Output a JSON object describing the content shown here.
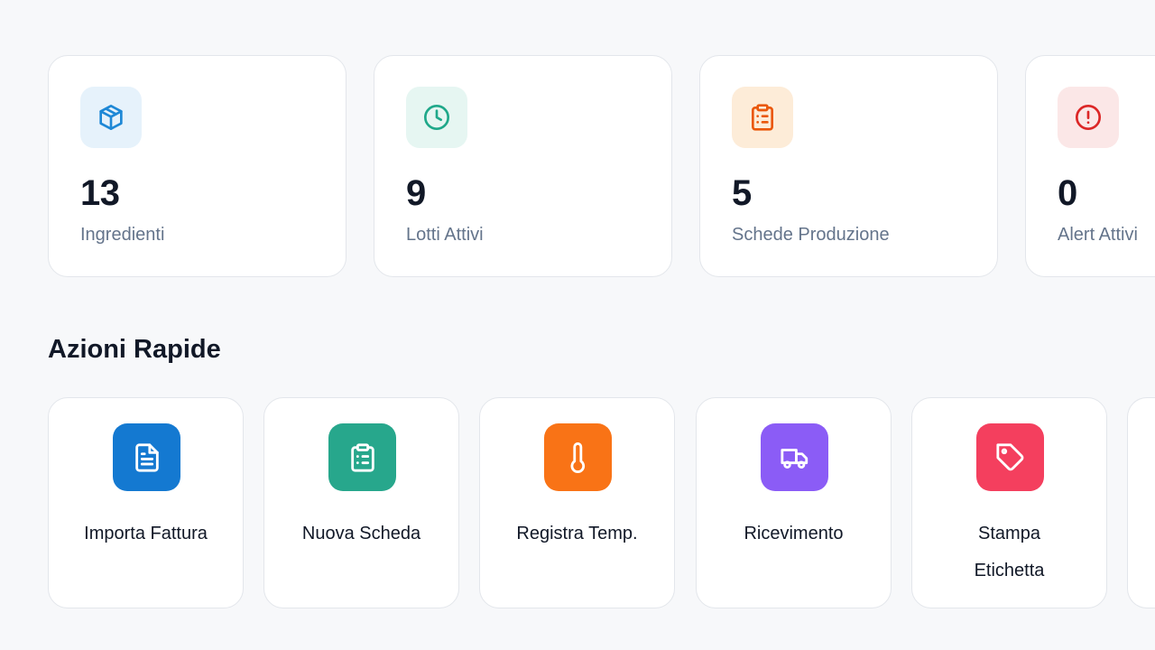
{
  "stats": [
    {
      "value": "13",
      "label": "Ingredienti",
      "icon": "package-icon",
      "color": "#1e88d6",
      "bg": "#e6f2fb"
    },
    {
      "value": "9",
      "label": "Lotti Attivi",
      "icon": "clock-icon",
      "color": "#1fa88a",
      "bg": "#e6f6f2"
    },
    {
      "value": "5",
      "label": "Schede Produzione",
      "icon": "clipboard-icon",
      "color": "#ea580c",
      "bg": "#fdecd8"
    },
    {
      "value": "0",
      "label": "Alert Attivi",
      "icon": "alert-circle-icon",
      "color": "#dc2626",
      "bg": "#fbe7e7"
    }
  ],
  "quick_actions": {
    "title": "Azioni Rapide",
    "items": [
      {
        "label": "Importa Fattura",
        "icon": "file-text-icon",
        "color": "#1479d1"
      },
      {
        "label": "Nuova Scheda",
        "icon": "clipboard-list-icon",
        "color": "#27a78c"
      },
      {
        "label": "Registra Temp.",
        "icon": "thermometer-icon",
        "color": "#f97316"
      },
      {
        "label": "Ricevimento",
        "icon": "truck-icon",
        "color": "#8b5cf6"
      },
      {
        "label": "Stampa Etichetta",
        "icon": "tag-icon",
        "color": "#f43f5e"
      }
    ]
  }
}
